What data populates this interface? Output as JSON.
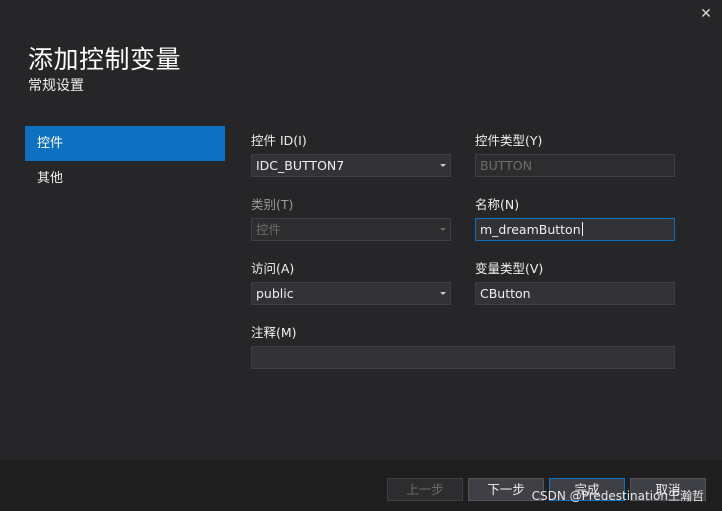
{
  "dialog": {
    "title": "添加控制变量",
    "subtitle": "常规设置",
    "close_icon_glyph": "✕"
  },
  "nav": {
    "items": [
      {
        "label": "控件",
        "active": true
      },
      {
        "label": "其他",
        "active": false
      }
    ]
  },
  "form": {
    "control_id": {
      "label": "控件 ID(I)",
      "value": "IDC_BUTTON7"
    },
    "control_type": {
      "label": "控件类型(Y)",
      "value": "BUTTON"
    },
    "category": {
      "label": "类别(T)",
      "value": "控件"
    },
    "name": {
      "label": "名称(N)",
      "value": "m_dreamButton"
    },
    "access": {
      "label": "访问(A)",
      "value": "public"
    },
    "variable_type": {
      "label": "变量类型(V)",
      "value": "CButton"
    },
    "comment": {
      "label": "注释(M)",
      "value": ""
    }
  },
  "footer": {
    "prev_label": "上一步",
    "next_label": "下一步",
    "finish_label": "完成",
    "cancel_label": "取消",
    "watermark": "CSDN @Predestination王瀚哲"
  },
  "colors": {
    "accent": "#0e70c0",
    "background": "#262628",
    "footer": "#1f1f1f"
  }
}
